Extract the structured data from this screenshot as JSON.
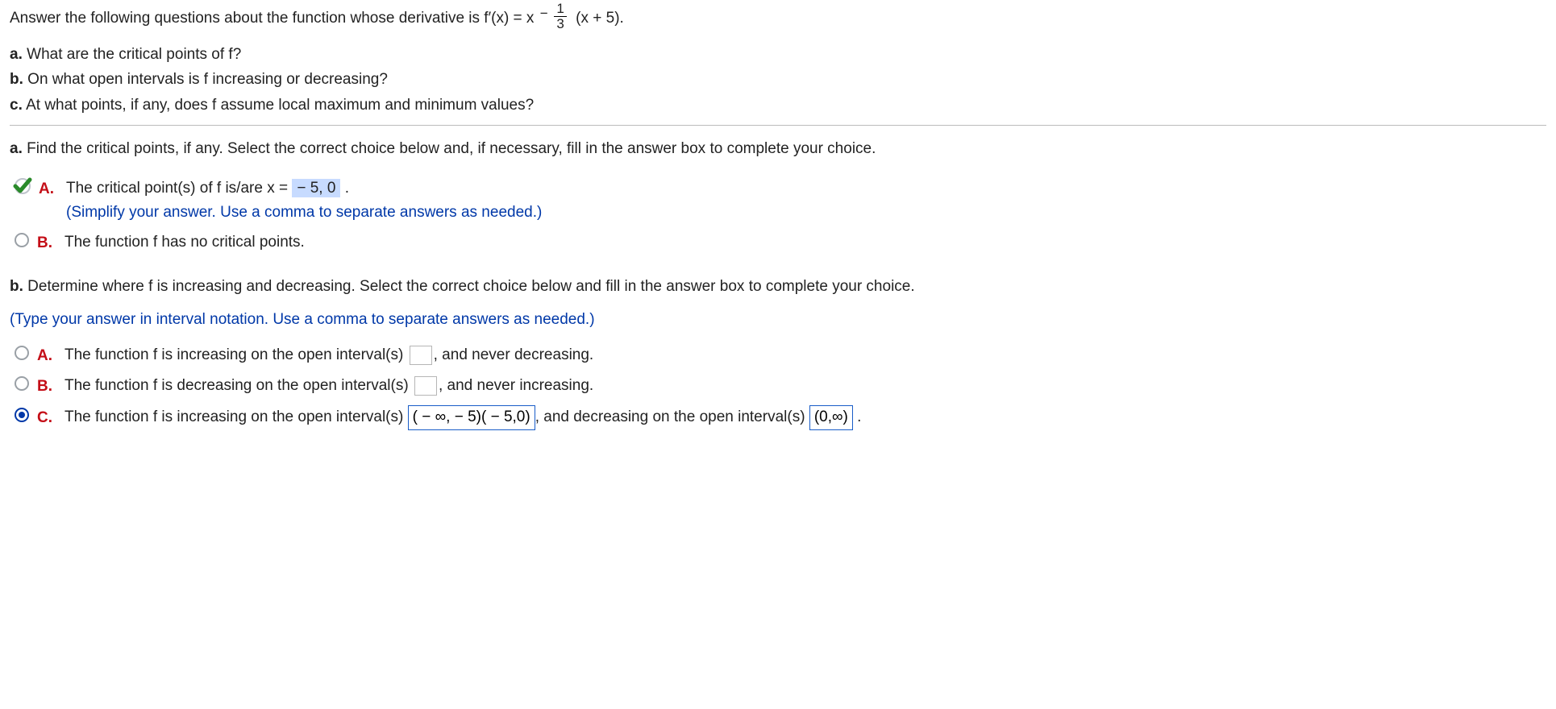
{
  "intro": {
    "line1_pre": "Answer the following questions about the function whose derivative is f′(x) = x",
    "exp_minus": "−",
    "exp_num": "1",
    "exp_den": "3",
    "line1_post": "(x + 5).",
    "a": "a.",
    "a_text": " What are the critical points of f?",
    "b": "b.",
    "b_text": " On what open intervals is f increasing or decreasing?",
    "c": "c.",
    "c_text": " At what points, if any, does f assume local maximum and minimum values?"
  },
  "partA": {
    "prompt_bold": "a.",
    "prompt_text": " Find the critical points, if any. Select the correct choice below and, if necessary, fill in the answer box to complete your choice.",
    "A_label": "A.",
    "A_text_pre": "The critical point(s) of f is/are x = ",
    "A_value": "− 5, 0",
    "A_text_post": " .",
    "A_note": "(Simplify your answer. Use a comma to separate answers as needed.)",
    "B_label": "B.",
    "B_text": "The function f has no critical points."
  },
  "partB": {
    "prompt_bold": "b.",
    "prompt_text": " Determine where f is increasing and decreasing. Select the correct choice below and fill in the answer box to complete your choice.",
    "note": "(Type your answer in interval notation. Use a comma to separate answers as needed.)",
    "A_label": "A.",
    "A_pre": "The function f is increasing on the open interval(s) ",
    "A_post": ", and never decreasing.",
    "B_label": "B.",
    "B_pre": "The function f is decreasing on the open interval(s) ",
    "B_post": ", and never increasing.",
    "C_label": "C.",
    "C_pre": "The function f is increasing on the open interval(s) ",
    "C_val1": "( − ∞, − 5)( − 5,0)",
    "C_mid": ", and decreasing on the open interval(s) ",
    "C_val2": "(0,∞)",
    "C_post": " ."
  },
  "chart_data": null
}
